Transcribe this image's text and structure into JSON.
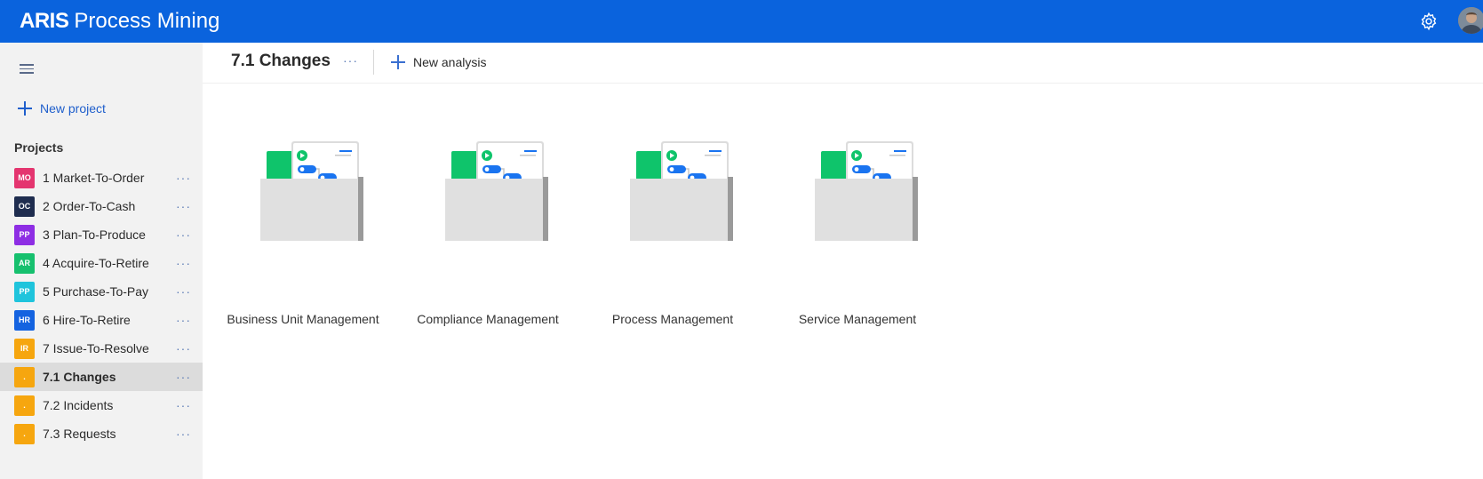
{
  "app": {
    "title_bold": "ARIS",
    "title_rest": "Process Mining",
    "colors": {
      "brand": "#0a63dd",
      "link": "#1f5fcc",
      "folder_tab": "#0fc46b",
      "node": "#1a74f0"
    }
  },
  "sidebar": {
    "new_project_label": "New project",
    "projects_heading": "Projects",
    "more_label": "···",
    "items": [
      {
        "badge": "MO",
        "label": "1 Market-To-Order",
        "color": "#e4356f"
      },
      {
        "badge": "OC",
        "label": "2 Order-To-Cash",
        "color": "#1f2d4f"
      },
      {
        "badge": "PP",
        "label": "3 Plan-To-Produce",
        "color": "#8e2ee4"
      },
      {
        "badge": "AR",
        "label": "4 Acquire-To-Retire",
        "color": "#16c06e"
      },
      {
        "badge": "PP",
        "label": "5 Purchase-To-Pay",
        "color": "#1fc4dc"
      },
      {
        "badge": "HR",
        "label": "6 Hire-To-Retire",
        "color": "#1463e0"
      },
      {
        "badge": "IR",
        "label": "7 Issue-To-Resolve",
        "color": "#f6a60f"
      },
      {
        "badge": ".",
        "label": "7.1 Changes",
        "color": "#f6a60f",
        "active": true
      },
      {
        "badge": ".",
        "label": "7.2 Incidents",
        "color": "#f6a60f"
      },
      {
        "badge": ".",
        "label": "7.3 Requests",
        "color": "#f6a60f"
      }
    ]
  },
  "header": {
    "title": "7.1 Changes",
    "more_label": "···",
    "new_analysis_label": "New analysis"
  },
  "analyses": [
    {
      "label": "Business Unit Management"
    },
    {
      "label": "Compliance Management"
    },
    {
      "label": "Process Management"
    },
    {
      "label": "Service Management"
    }
  ]
}
